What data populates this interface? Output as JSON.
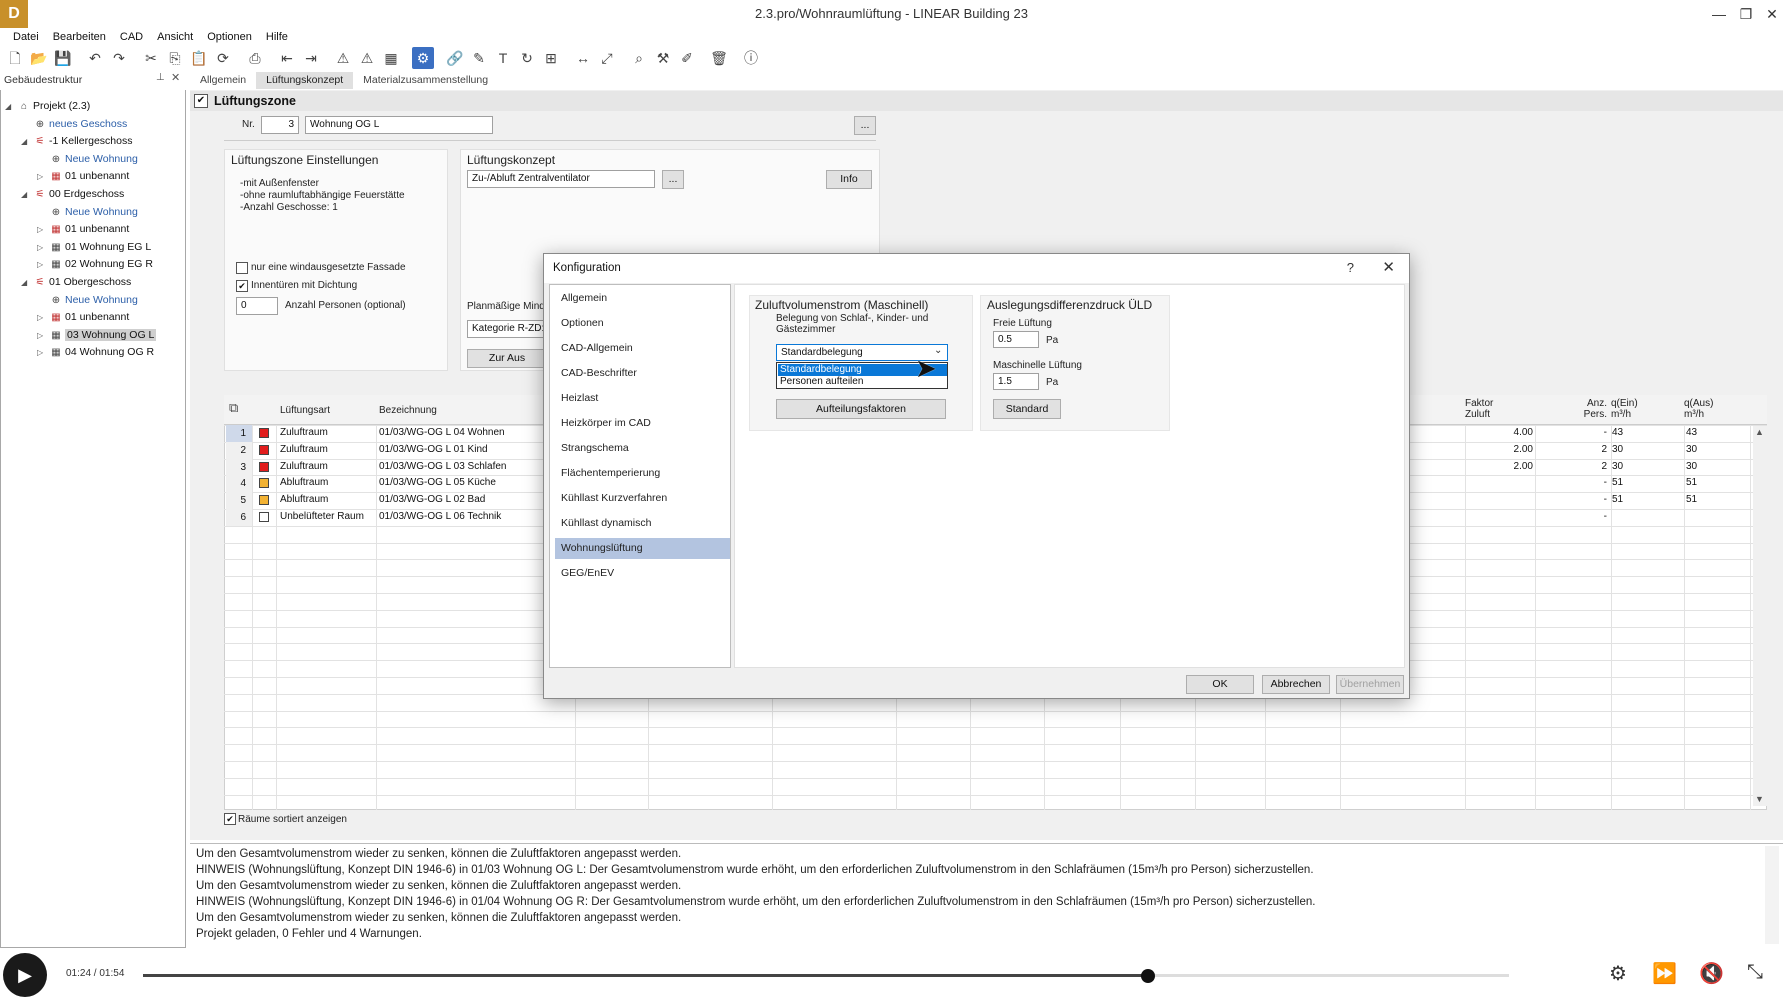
{
  "window": {
    "title": "2.3.pro/Wohnraumlüftung - LINEAR Building 23",
    "logo": "D"
  },
  "menu": [
    "Datei",
    "Bearbeiten",
    "CAD",
    "Ansicht",
    "Optionen",
    "Hilfe"
  ],
  "left_panel": {
    "header": "Gebäudestruktur"
  },
  "tree": [
    {
      "label": "Projekt (2.3)",
      "icon": "project-icon",
      "level": 0,
      "exp": "◢",
      "link": false
    },
    {
      "label": "neues Geschoss",
      "icon": "add-icon",
      "level": 1,
      "exp": "",
      "link": true
    },
    {
      "label": "-1 Kellergeschoss",
      "icon": "floor-icon",
      "level": 1,
      "exp": "◢",
      "link": false
    },
    {
      "label": "Neue Wohnung",
      "icon": "add-icon",
      "level": 2,
      "exp": "",
      "link": true
    },
    {
      "label": "01 unbenannt",
      "icon": "room-icon",
      "level": 2,
      "exp": "▷",
      "link": false
    },
    {
      "label": "00 Erdgeschoss",
      "icon": "floor-icon",
      "level": 1,
      "exp": "◢",
      "link": false
    },
    {
      "label": "Neue Wohnung",
      "icon": "add-icon",
      "level": 2,
      "exp": "",
      "link": true
    },
    {
      "label": "01 unbenannt",
      "icon": "room-icon",
      "level": 2,
      "exp": "▷",
      "link": false
    },
    {
      "label": "01 Wohnung EG L",
      "icon": "room-icon",
      "level": 2,
      "exp": "▷",
      "link": false
    },
    {
      "label": "02 Wohnung EG R",
      "icon": "room-icon",
      "level": 2,
      "exp": "▷",
      "link": false
    },
    {
      "label": "01 Obergeschoss",
      "icon": "floor-icon",
      "level": 1,
      "exp": "◢",
      "link": false
    },
    {
      "label": "Neue Wohnung",
      "icon": "add-icon",
      "level": 2,
      "exp": "",
      "link": true
    },
    {
      "label": "01 unbenannt",
      "icon": "room-icon",
      "level": 2,
      "exp": "▷",
      "link": false
    },
    {
      "label": "03 Wohnung OG L",
      "icon": "room-icon",
      "level": 2,
      "exp": "▷",
      "link": false,
      "selected": true
    },
    {
      "label": "04 Wohnung OG R",
      "icon": "room-icon",
      "level": 2,
      "exp": "▷",
      "link": false
    }
  ],
  "tabs": [
    "Allgemein",
    "Lüftungskonzept",
    "Materialzusammenstellung"
  ],
  "zone": {
    "header": "Lüftungszone",
    "nr_label": "Nr.",
    "nr_value": "3",
    "name_value": "Wohnung OG L",
    "more": "...",
    "settings": {
      "title": "Lüftungszone Einstellungen",
      "lines": [
        "-mit Außenfenster",
        "-ohne raumluftabhängige Feuerstätte",
        "-Anzahl Geschosse: 1"
      ],
      "cb1": "nur eine windausgesetzte Fassade",
      "cb2": "Innentüren mit Dichtung",
      "persons_value": "0",
      "persons_label": "Anzahl Personen (optional)"
    },
    "concept": {
      "title": "Lüftungskonzept",
      "value": "Zu-/Abluft Zentralventilator",
      "more": "...",
      "info": "Info",
      "plan_label": "Planmäßige Minde",
      "kat": "Kategorie R-ZD:",
      "zur": "Zur Aus"
    }
  },
  "grid": {
    "headers": {
      "art": "Lüftungsart",
      "bez": "Bezeichnung",
      "faktor": "Faktor\nZuluft",
      "anz": "Anz.\nPers.",
      "qein": "q(Ein)\nm³/h",
      "qaus": "q(Aus)\nm³/h"
    },
    "rows": [
      {
        "n": "1",
        "color": "#e21d1d",
        "art": "Zuluftraum",
        "bez": "01/03/WG-OG L 04 Wohnen",
        "faktor": "4.00",
        "anz": "-",
        "qein": "43",
        "qaus": "43"
      },
      {
        "n": "2",
        "color": "#e21d1d",
        "art": "Zuluftraum",
        "bez": "01/03/WG-OG L 01 Kind",
        "faktor": "2.00",
        "anz": "2",
        "qein": "30",
        "qaus": "30"
      },
      {
        "n": "3",
        "color": "#e21d1d",
        "art": "Zuluftraum",
        "bez": "01/03/WG-OG L 03 Schlafen",
        "faktor": "2.00",
        "anz": "2",
        "qein": "30",
        "qaus": "30"
      },
      {
        "n": "4",
        "color": "#f2b233",
        "art": "Abluftraum",
        "bez": "01/03/WG-OG L 05 Küche",
        "faktor": "",
        "anz": "-",
        "qein": "51",
        "qaus": "51"
      },
      {
        "n": "5",
        "color": "#f2b233",
        "art": "Abluftraum",
        "bez": "01/03/WG-OG L 02 Bad",
        "faktor": "",
        "anz": "-",
        "qein": "51",
        "qaus": "51"
      },
      {
        "n": "6",
        "color": "#ffffff",
        "art": "Unbelüfteter Raum",
        "bez": "01/03/WG-OG L 06 Technik",
        "faktor": "",
        "anz": "-",
        "qein": "",
        "qaus": ""
      }
    ],
    "sorted_label": "Räume sortiert anzeigen"
  },
  "log": [
    "    Um den Gesamtvolumenstrom wieder zu senken, können die Zuluftfaktoren angepasst werden.",
    "HINWEIS (Wohnungslüftung, Konzept DIN 1946-6) in 01/03 Wohnung OG L: Der Gesamtvolumenstrom wurde erhöht, um den erforderlichen Zuluftvolumenstrom in den Schlafräumen (15m³/h pro Person) sicherzustellen.",
    "    Um den Gesamtvolumenstrom wieder zu senken, können die Zuluftfaktoren angepasst werden.",
    "HINWEIS (Wohnungslüftung, Konzept DIN 1946-6) in 01/04 Wohnung OG R: Der Gesamtvolumenstrom wurde erhöht, um den erforderlichen Zuluftvolumenstrom in den Schlafräumen (15m³/h pro Person) sicherzustellen.",
    "    Um den Gesamtvolumenstrom wieder zu senken, können die Zuluftfaktoren angepasst werden.",
    "Projekt geladen, 0 Fehler und 4 Warnungen."
  ],
  "dialog": {
    "title": "Konfiguration",
    "help": "?",
    "nav": [
      "Allgemein",
      "Optionen",
      "CAD-Allgemein",
      "CAD-Beschrifter",
      "Heizlast",
      "Heizkörper im CAD",
      "Strangschema",
      "Flächentemperierung",
      "Kühllast Kurzverfahren",
      "Kühllast dynamisch",
      "Wohnungslüftung",
      "GEG/EnEV"
    ],
    "nav_selected": 10,
    "zuluft": {
      "title": "Zuluftvolumenstrom (Maschinell)",
      "desc": "Belegung von Schlaf-, Kinder- und Gästezimmer",
      "select_value": "Standardbelegung",
      "options": [
        "Standardbelegung",
        "Personen aufteilen"
      ],
      "factors_button": "Aufteilungsfaktoren"
    },
    "uld": {
      "title": "Auslegungsdifferenzdruck ÜLD",
      "free_label": "Freie Lüftung",
      "free_value": "0.5",
      "unit": "Pa",
      "mech_label": "Maschinelle Lüftung",
      "mech_value": "1.5",
      "standard_button": "Standard"
    },
    "ok": "OK",
    "cancel": "Abbrechen",
    "apply": "Übernehmen"
  },
  "player": {
    "time": "01:24 / 01:54",
    "progress": 0.736
  }
}
